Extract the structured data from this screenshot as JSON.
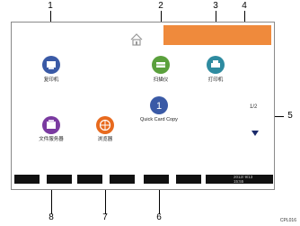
{
  "callouts": [
    "1",
    "2",
    "3",
    "4",
    "5",
    "6",
    "7",
    "8"
  ],
  "apps": [
    {
      "label": "复印机",
      "icon": "copier-icon",
      "color": "#3a5aa6"
    },
    {
      "label": "扫描仪",
      "icon": "scanner-icon",
      "color": "#5aa03c"
    },
    {
      "label": "打印机",
      "icon": "printer-icon",
      "color": "#2e8ba0"
    },
    {
      "label": "文件服务器",
      "icon": "document-server-icon",
      "color": "#7a3aa0"
    },
    {
      "label": "浏览器",
      "icon": "browser-icon",
      "color": "#e86a1e"
    },
    {
      "label": "Quick Card Copy",
      "icon": "quick-copy-icon",
      "color": "#3a5aa6"
    }
  ],
  "pagination": {
    "page": "1/2"
  },
  "status_bar": {
    "date": "2012/ 9/13",
    "time": "15:55"
  },
  "doc_id": "CPL016"
}
